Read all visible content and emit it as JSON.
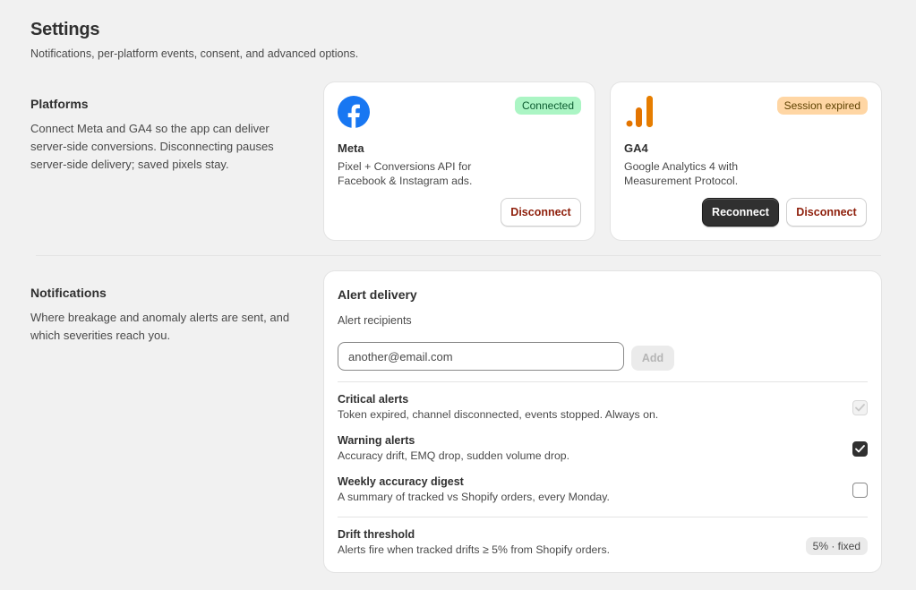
{
  "header": {
    "title": "Settings",
    "subtitle": "Notifications, per-platform events, consent, and advanced options."
  },
  "platforms": {
    "title": "Platforms",
    "description": "Connect Meta and GA4 so the app can deliver server-side conversions. Disconnecting pauses server-side delivery; saved pixels stay.",
    "meta": {
      "name": "Meta",
      "description": "Pixel + Conversions API for Facebook & Instagram ads.",
      "status": "Connected",
      "disconnect_label": "Disconnect",
      "icon": "facebook-logo"
    },
    "ga4": {
      "name": "GA4",
      "description": "Google Analytics 4 with Measurement Protocol.",
      "status": "Session expired",
      "reconnect_label": "Reconnect",
      "disconnect_label": "Disconnect",
      "icon": "google-analytics-logo"
    }
  },
  "notifications": {
    "title": "Notifications",
    "description": "Where breakage and anomaly alerts are sent, and which severities reach you.",
    "card": {
      "title": "Alert delivery",
      "recipients_label": "Alert recipients",
      "email_placeholder": "another@email.com",
      "add_label": "Add",
      "alerts": [
        {
          "title": "Critical alerts",
          "description": "Token expired, channel disconnected, events stopped. Always on.",
          "checked": true,
          "disabled": true
        },
        {
          "title": "Warning alerts",
          "description": "Accuracy drift, EMQ drop, sudden volume drop.",
          "checked": true,
          "disabled": false
        },
        {
          "title": "Weekly accuracy digest",
          "description": "A summary of tracked vs Shopify orders, every Monday.",
          "checked": false,
          "disabled": false
        }
      ],
      "threshold": {
        "title": "Drift threshold",
        "description": "Alerts fire when tracked drifts ≥ 5% from Shopify orders.",
        "value": "5% · fixed"
      }
    }
  },
  "colors": {
    "connected_bg": "#abf5c4",
    "expired_bg": "#ffd6a4",
    "facebook_blue": "#1877f2",
    "ga4_orange": "#e37400",
    "critical_text": "#8e1f0b"
  }
}
